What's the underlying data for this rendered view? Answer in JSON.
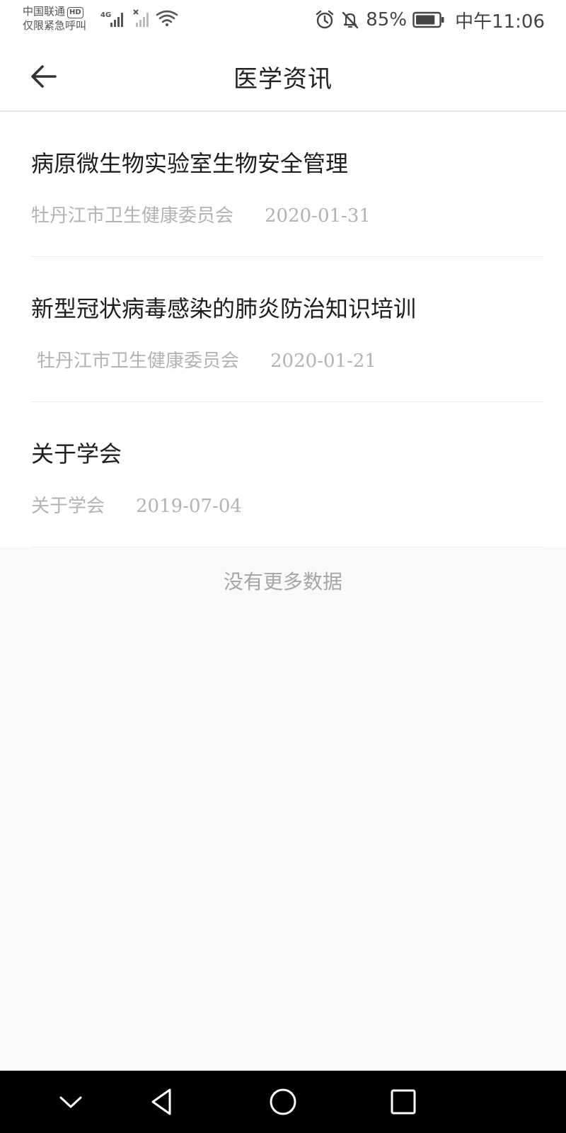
{
  "status_bar": {
    "carrier_line1": "中国联通",
    "hd_badge": "HD",
    "carrier_line2": "仅限紧急呼叫",
    "network": "4G",
    "battery_percent": "85%",
    "battery_level": 0.85,
    "time": "中午11:06"
  },
  "header": {
    "title": "医学资讯"
  },
  "news": [
    {
      "title": "病原微生物实验室生物安全管理",
      "source": "牡丹江市卫生健康委员会",
      "date": "2020-01-31"
    },
    {
      "title": "新型冠状病毒感染的肺炎防治知识培训",
      "source": "牡丹江市卫生健康委员会",
      "date": "2020-01-21"
    },
    {
      "title": "关于学会",
      "source": "关于学会",
      "date": "2019-07-04"
    }
  ],
  "list_footer": "没有更多数据"
}
